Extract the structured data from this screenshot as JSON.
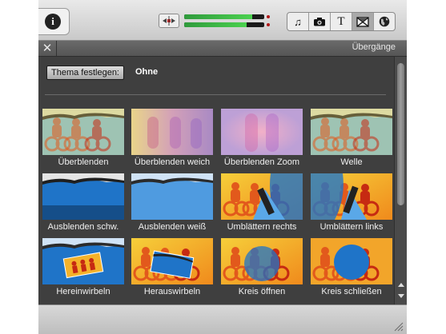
{
  "toolbar": {
    "info_icon": "info-icon",
    "info_glyph": "i",
    "volume_levels": [
      0.85,
      0.78
    ],
    "browser_buttons": [
      {
        "name": "music-icon",
        "glyph": "♫",
        "active": false
      },
      {
        "name": "camera-icon",
        "glyph": "camera",
        "active": false
      },
      {
        "name": "title-icon",
        "glyph": "T",
        "active": false
      },
      {
        "name": "transitions-icon",
        "glyph": "transitions",
        "active": true
      },
      {
        "name": "globe-icon",
        "glyph": "globe",
        "active": false
      }
    ]
  },
  "panel": {
    "close_glyph": "✕",
    "title": "Übergänge",
    "theme_button_label": "Thema festlegen:",
    "theme_value": "Ohne"
  },
  "transitions": [
    {
      "label": "Überblenden",
      "style": "cyclists-crossfade"
    },
    {
      "label": "Überblenden weich",
      "style": "blur-soft"
    },
    {
      "label": "Überblenden Zoom",
      "style": "blur-zoom"
    },
    {
      "label": "Welle",
      "style": "cyclists-crossfade"
    },
    {
      "label": "Ausblenden schw.",
      "style": "lake-dark"
    },
    {
      "label": "Ausblenden weiß",
      "style": "lake-light"
    },
    {
      "label": "Umblättern rechts",
      "style": "page-curl-right"
    },
    {
      "label": "Umblättern links",
      "style": "page-curl-left"
    },
    {
      "label": "Hereinwirbeln",
      "style": "spin-in"
    },
    {
      "label": "Herauswirbeln",
      "style": "spin-out"
    },
    {
      "label": "Kreis öffnen",
      "style": "circle-open"
    },
    {
      "label": "Kreis schließen",
      "style": "circle-close"
    }
  ],
  "colors": {
    "panel_bg": "#3f3f3f",
    "cyclist_red": "#c62a12",
    "cyclist_yellow": "#f2b21c",
    "lake_blue": "#1f74c8",
    "meter_green": "#3fc14a"
  }
}
